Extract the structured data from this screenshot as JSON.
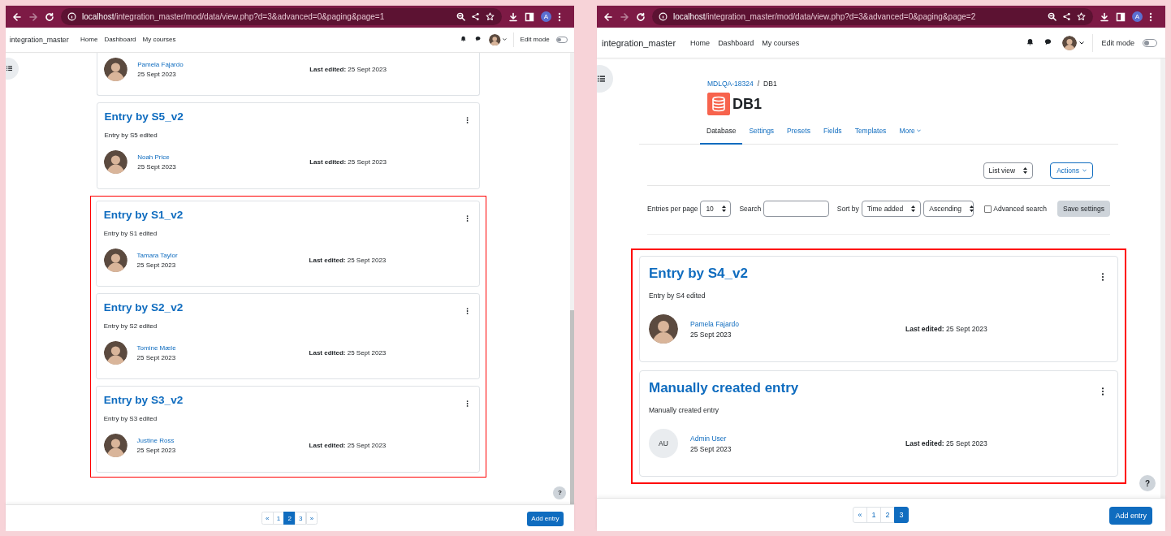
{
  "windows": [
    {
      "address": {
        "host": "localhost",
        "path": "/integration_master/mod/data/view.php?d=3&advanced=0&paging&page=1"
      },
      "forward_enabled": false,
      "profile": "A",
      "site_name": "integration_master",
      "nav": [
        "Home",
        "Dashboard",
        "My courses"
      ],
      "edit_mode": {
        "label": "Edit mode",
        "on": false
      },
      "entries": [
        {
          "author": {
            "name": "Pamela Fajardo",
            "avatar": {
              "kind": "photo"
            },
            "date": "25 Sept 2023"
          },
          "last_edited": "**Last edited:** 25 Sept 2023",
          "highlighted": false
        },
        {
          "title": "Entry by S5_v2",
          "description": "Entry by S5 edited",
          "author": {
            "name": "Noah Price",
            "avatar": {
              "kind": "photo"
            },
            "date": "25 Sept 2023"
          },
          "last_edited": "**Last edited:** 25 Sept 2023",
          "highlighted": false
        },
        {
          "title": "Entry by S1_v2",
          "description": "Entry by S1 edited",
          "author": {
            "name": "Tamara Taylor",
            "avatar": {
              "kind": "photo"
            },
            "date": "25 Sept 2023"
          },
          "last_edited": "**Last edited:** 25 Sept 2023",
          "highlighted": true
        },
        {
          "title": "Entry by S2_v2",
          "description": "Entry by S2 edited",
          "author": {
            "name": "Tomine Mæle",
            "avatar": {
              "kind": "photo"
            },
            "date": "25 Sept 2023"
          },
          "last_edited": "**Last edited:** 25 Sept 2023",
          "highlighted": true
        },
        {
          "title": "Entry by S3_v2",
          "description": "Entry by S3 edited",
          "author": {
            "name": "Justine Ross",
            "avatar": {
              "kind": "photo"
            },
            "date": "25 Sept 2023"
          },
          "last_edited": "**Last edited:** 25 Sept 2023",
          "highlighted": true
        }
      ],
      "pagination": [
        {
          "label": "«",
          "selected": false
        },
        {
          "label": "1",
          "selected": false
        },
        {
          "label": "2",
          "selected": true
        },
        {
          "label": "3",
          "selected": false
        },
        {
          "label": "»",
          "selected": false
        }
      ],
      "add_button": "Add entry",
      "help": "?"
    },
    {
      "address": {
        "host": "localhost",
        "path": "/integration_master/mod/data/view.php?d=3&advanced=0&paging&page=2"
      },
      "forward_enabled": false,
      "profile": "A",
      "site_name": "integration_master",
      "nav": [
        "Home",
        "Dashboard",
        "My courses"
      ],
      "edit_mode": {
        "label": "Edit mode",
        "on": false
      },
      "page": {
        "breadcrumb": [
          "MDLQA-18324",
          "DB1"
        ],
        "breadcrumb_separator": "/",
        "heading": "DB1",
        "tabs": [
          {
            "label": "Database",
            "selected": true,
            "kind": "link"
          },
          {
            "label": "Settings",
            "selected": false,
            "kind": "link"
          },
          {
            "label": "Presets",
            "selected": false,
            "kind": "link"
          },
          {
            "label": "Fields",
            "selected": false,
            "kind": "link"
          },
          {
            "label": "Templates",
            "selected": false,
            "kind": "link"
          },
          {
            "label": "More",
            "selected": false,
            "kind": "menu"
          }
        ],
        "view_select": "List view",
        "actions_button": "Actions",
        "filters": {
          "entries_per_page": {
            "label": "Entries per page",
            "value": "10"
          },
          "search": {
            "label": "Search"
          },
          "sort_by": {
            "label": "Sort by",
            "value": "Time added"
          },
          "order": {
            "value": "Ascending"
          },
          "advanced_search": {
            "label": "Advanced search",
            "checked": false
          },
          "save_button": "Save settings"
        }
      },
      "entries": [
        {
          "title": "Entry by S4_v2",
          "description": "Entry by S4 edited",
          "author": {
            "name": "Pamela Fajardo",
            "avatar": {
              "kind": "photo"
            },
            "date": "25 Sept 2023"
          },
          "last_edited": "**Last edited:** 25 Sept 2023",
          "highlighted": true
        },
        {
          "title": "Manually created entry",
          "description": "Manually created entry",
          "author": {
            "name": "Admin User",
            "avatar": {
              "kind": "initials",
              "text": "AU"
            },
            "date": "25 Sept 2023"
          },
          "last_edited": "**Last edited:** 25 Sept 2023",
          "highlighted": true
        }
      ],
      "pagination": [
        {
          "label": "«",
          "selected": false
        },
        {
          "label": "1",
          "selected": false
        },
        {
          "label": "2",
          "selected": false
        },
        {
          "label": "3",
          "selected": true
        }
      ],
      "add_button": "Add entry",
      "help": "?"
    }
  ]
}
